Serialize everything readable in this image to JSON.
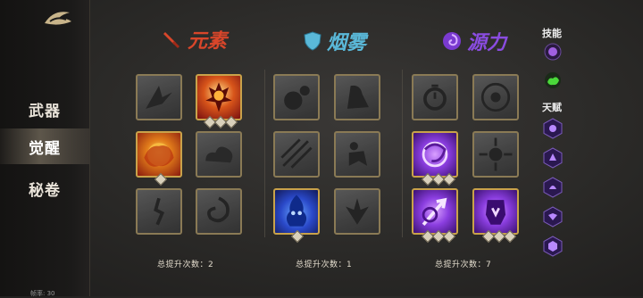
{
  "sidebar": {
    "items": [
      {
        "label": "武器"
      },
      {
        "label": "觉醒"
      },
      {
        "label": "秘卷"
      }
    ],
    "fps": "帧率: 30"
  },
  "columns": [
    {
      "title": "元素",
      "count_label": "总提升次数：2",
      "color": "#d8462a"
    },
    {
      "title": "烟雾",
      "count_label": "总提升次数：1",
      "color": "#5ab8d8"
    },
    {
      "title": "源力",
      "count_label": "总提升次数：7",
      "color": "#8a4ce0"
    }
  ],
  "right_panel": {
    "skills_label": "技能",
    "talents_label": "天赋"
  }
}
